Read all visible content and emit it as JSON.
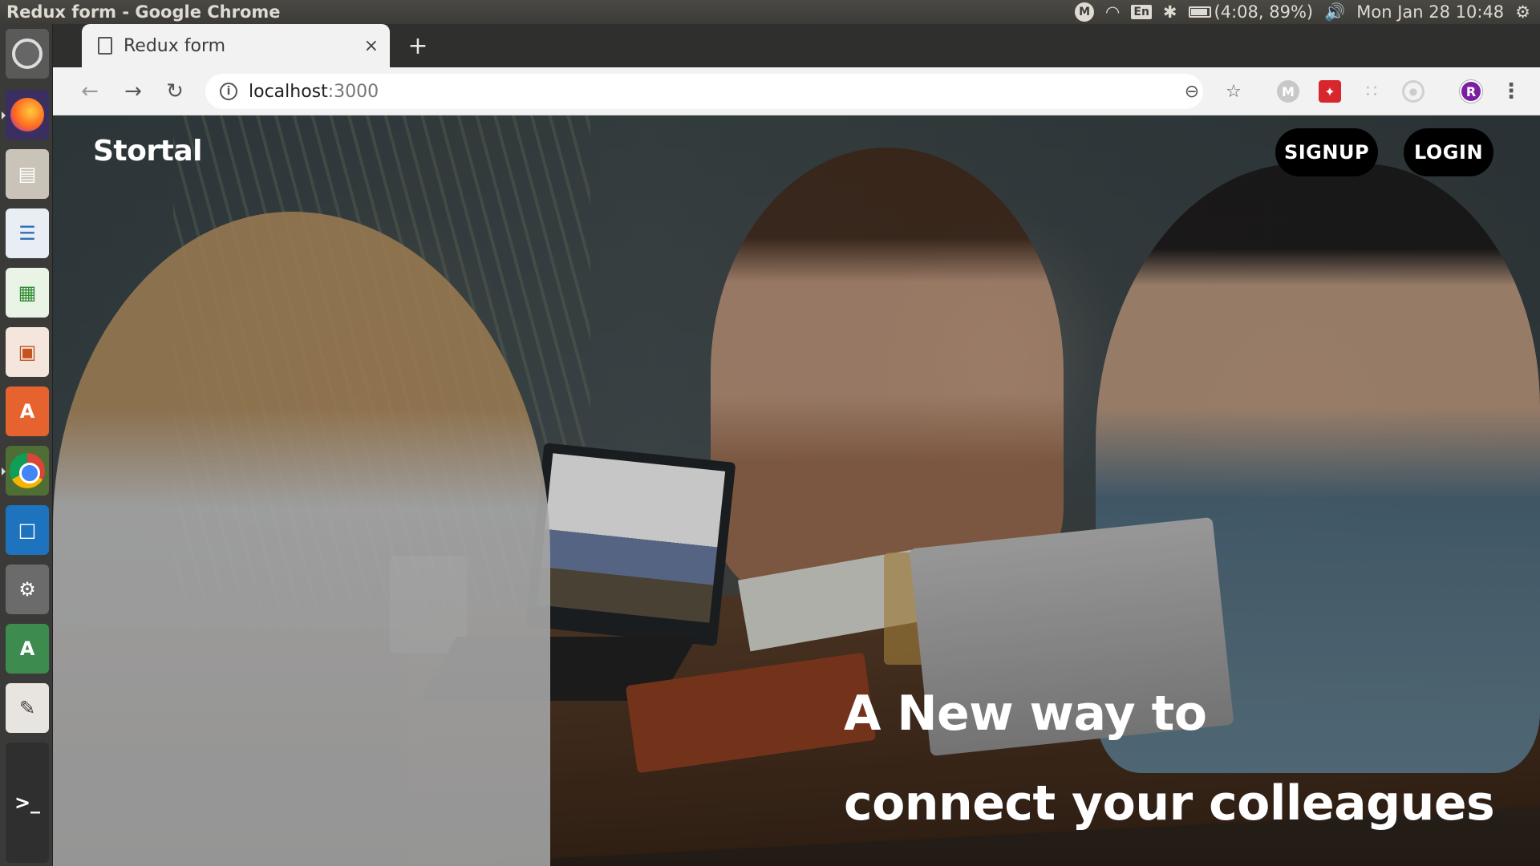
{
  "window": {
    "title": "Redux form - Google Chrome"
  },
  "panel": {
    "battery": "(4:08, 89%)",
    "clock": "Mon Jan 28 10:48",
    "keyboard": "En",
    "mail_indicator": "M"
  },
  "browser": {
    "tab": {
      "title": "Redux form",
      "close": "×"
    },
    "new_tab": "+",
    "url_host": "localhost",
    "url_port": ":3000",
    "avatar_initial": "R",
    "ext_m": "M"
  },
  "page": {
    "brand": "Stortal",
    "nav": {
      "signup": "SIGNUP",
      "login": "LOGIN"
    },
    "hero": {
      "line1": "A New way to",
      "line2": "connect your colleagues"
    }
  },
  "icons": {
    "launcher": [
      "ubuntu-icon",
      "firefox-icon",
      "files-icon",
      "writer-icon",
      "calc-icon",
      "impress-icon",
      "software-center-icon",
      "chrome-icon",
      "virtualbox-icon",
      "system-settings-icon",
      "android-studio-icon",
      "text-editor-icon",
      "terminal-icon"
    ],
    "toolbar": [
      "back-icon",
      "forward-icon",
      "reload-icon",
      "info-icon",
      "zoom-out-icon",
      "star-icon",
      "menu-icon"
    ]
  }
}
